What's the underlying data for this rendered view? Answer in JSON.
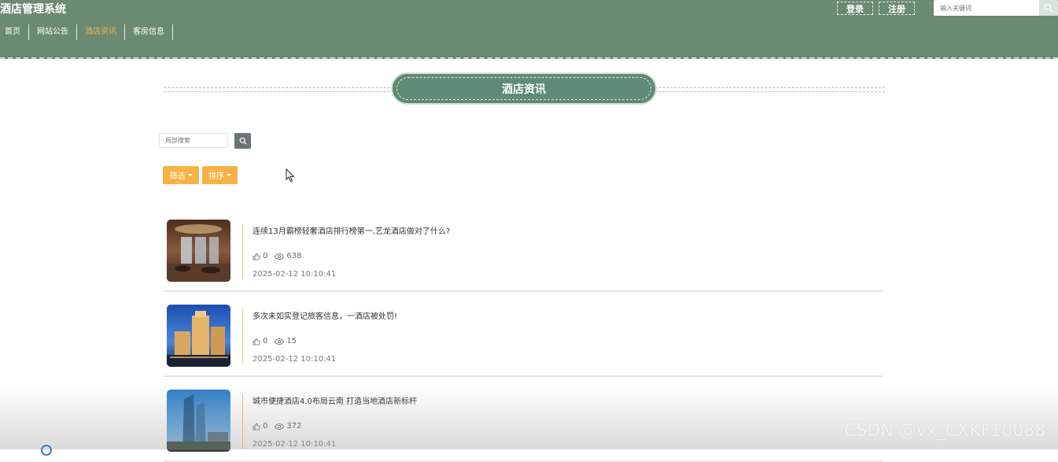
{
  "header": {
    "site_title": "酒店管理系统",
    "login_label": "登录",
    "register_label": "注册",
    "search_placeholder": "输入关键词",
    "nav": [
      "首页",
      "网站公告",
      "酒店资讯",
      "客房信息"
    ],
    "active_nav": "酒店资讯",
    "colors": {
      "header_bg": "#6b8a72",
      "active": "#f3b14a"
    }
  },
  "section": {
    "title": "酒店资讯",
    "local_search_placeholder": "局部搜索",
    "filter_label": "筛选",
    "sort_label": "排序"
  },
  "news": [
    {
      "title": "连续13月霸榜轻奢酒店排行榜第一,艺龙酒店做对了什么?",
      "likes": "0",
      "views": "638",
      "date": "2025-02-12 10:10:41"
    },
    {
      "title": "多次未如实登记旅客信息，一酒店被处罚!",
      "likes": "0",
      "views": "15",
      "date": "2025-02-12 10:10:41"
    },
    {
      "title": "城市便捷酒店4.0布局云南 打造当地酒店新标杆",
      "likes": "0",
      "views": "372",
      "date": "2025-02-12 10:10:41"
    }
  ],
  "watermark": "CSDN @vx_CXKF10088"
}
